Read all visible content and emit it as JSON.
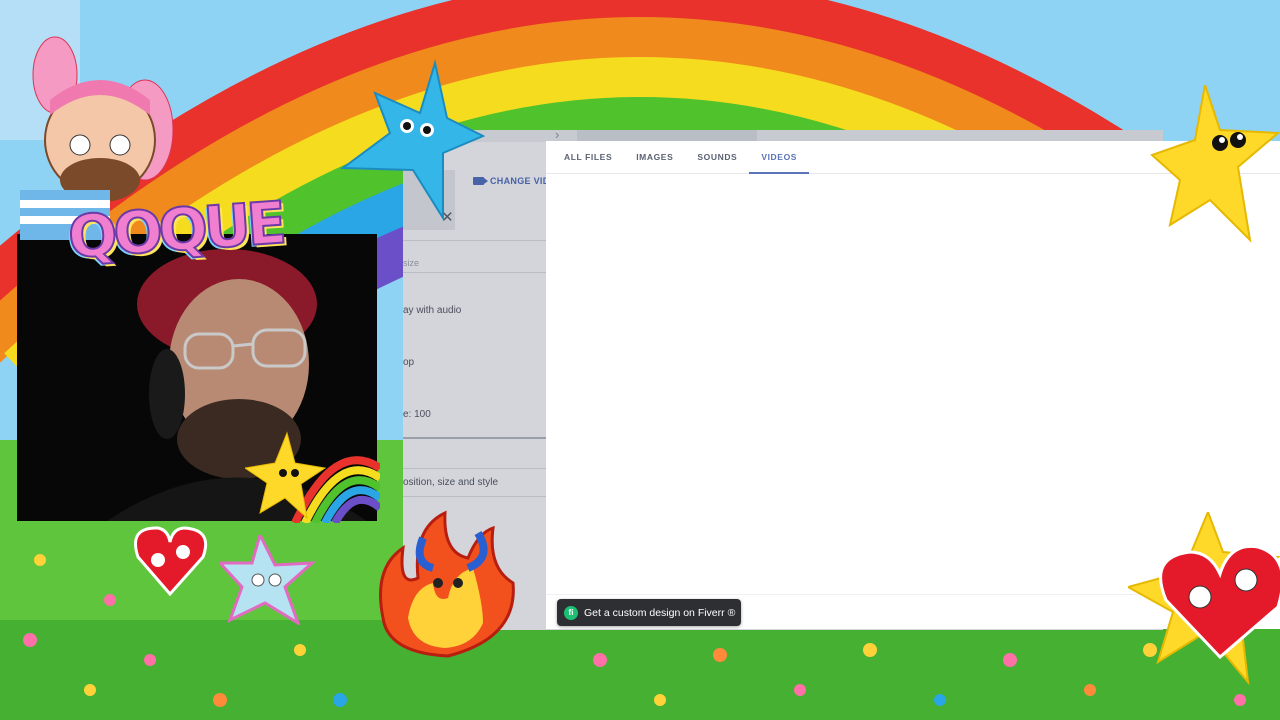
{
  "scene": {
    "colors": {
      "sky": "#8fd3f4",
      "grass": "#5fc53c",
      "rainbow": [
        "#e8322b",
        "#f08a1c",
        "#f6dc1e",
        "#4fc22c",
        "#2aa5e6",
        "#6a4fc9"
      ]
    }
  },
  "settings_panel": {
    "change_video_label": "CHANGE VID",
    "close_icon": "close-icon",
    "size_label": "size",
    "audio_option": "ay with audio",
    "loop_option": "op",
    "volume_label": "e: 100",
    "position_label": "osition, size and style"
  },
  "file_picker": {
    "tabs": [
      {
        "label": "ALL FILES",
        "active": false
      },
      {
        "label": "IMAGES",
        "active": false
      },
      {
        "label": "SOUNDS",
        "active": false
      },
      {
        "label": "VIDEOS",
        "active": true
      }
    ],
    "accent_color": "#5a74b8"
  },
  "fiverr_banner": {
    "icon_letter": "fi",
    "label": "Get a custom design on Fiverr",
    "trailing_icon": "®"
  },
  "stream_overlay": {
    "logo_text": "QOQUE"
  }
}
